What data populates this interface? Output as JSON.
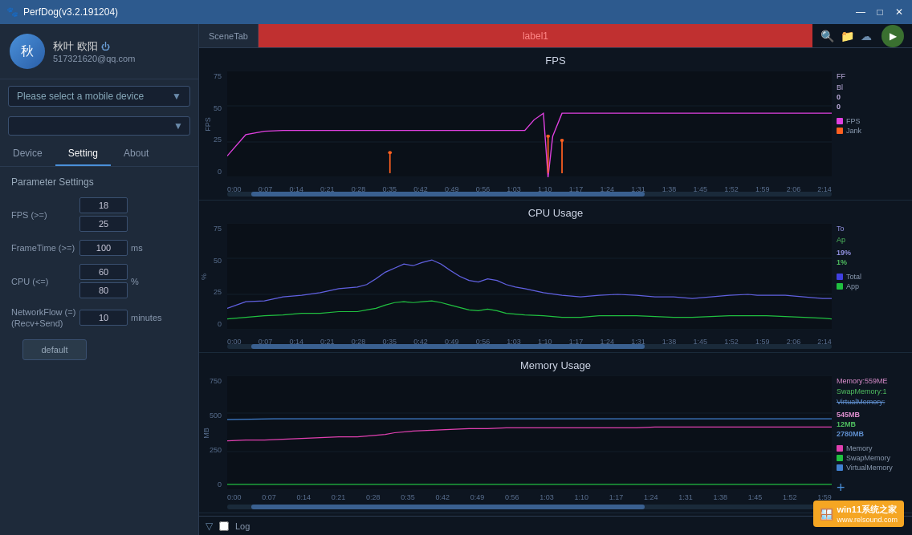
{
  "titlebar": {
    "title": "PerfDog(v3.2.191204)",
    "icon": "🐾",
    "min_btn": "—",
    "max_btn": "□",
    "close_btn": "✕"
  },
  "sidebar": {
    "user": {
      "name": "秋叶 欧阳",
      "email": "517321620@qq.com",
      "power_icon": "⏻"
    },
    "device_selector": {
      "placeholder": "Please select a mobile device",
      "arrow": "▼"
    },
    "search_arrow": "▼",
    "tabs": [
      {
        "id": "device",
        "label": "Device",
        "active": false
      },
      {
        "id": "setting",
        "label": "Setting",
        "active": true
      },
      {
        "id": "about",
        "label": "About",
        "active": false
      }
    ],
    "params": {
      "title": "Parameter Settings",
      "rows": [
        {
          "label": "FPS (>=)",
          "values": [
            "18",
            "25"
          ],
          "unit": ""
        },
        {
          "label": "FrameTime (>=)",
          "values": [
            "100"
          ],
          "unit": "ms"
        },
        {
          "label": "CPU (<=)",
          "values": [
            "60",
            "80"
          ],
          "unit": "%"
        },
        {
          "label": "NetworkFlow (=)\n(Recv+Send)",
          "values": [
            "10"
          ],
          "unit": "minutes"
        }
      ]
    },
    "default_btn": "default"
  },
  "main": {
    "scene_tab": {
      "tab_label": "SceneTab",
      "content_label": "label1",
      "icons": [
        "🔍",
        "📁",
        "☁"
      ],
      "play_btn": "▶"
    },
    "charts": [
      {
        "id": "fps",
        "title": "FPS",
        "y_label": "FPS",
        "y_ticks": [
          "75",
          "50",
          "25",
          "0"
        ],
        "x_ticks": [
          "0:00",
          "0:07",
          "0:14",
          "0:21",
          "0:28",
          "0:35",
          "0:42",
          "0:49",
          "0:56",
          "1:03",
          "1:10",
          "1:17",
          "1:24",
          "1:31",
          "1:38",
          "1:45",
          "1:52",
          "1:59",
          "2:06",
          "2:14"
        ],
        "legend": [
          {
            "label": "FPS",
            "color": "#e040e0",
            "current": "FF",
            "value": "0"
          },
          {
            "label": "Jank",
            "color": "#ff6020",
            "current": "Bl",
            "value": "0"
          }
        ],
        "scrollbar": {
          "left": "5%",
          "width": "70%"
        }
      },
      {
        "id": "cpu",
        "title": "CPU Usage",
        "y_label": "%",
        "y_ticks": [
          "75",
          "50",
          "25",
          "0"
        ],
        "x_ticks": [
          "0:00",
          "0:07",
          "0:14",
          "0:21",
          "0:28",
          "0:35",
          "0:42",
          "0:49",
          "0:56",
          "1:03",
          "1:10",
          "1:17",
          "1:24",
          "1:31",
          "1:38",
          "1:45",
          "1:52",
          "1:59",
          "2:06",
          "2:14"
        ],
        "legend": [
          {
            "label": "Total",
            "color": "#4040e0",
            "current": "To",
            "value": "19%"
          },
          {
            "label": "App",
            "color": "#20c040",
            "current": "Ap",
            "value": "1%"
          }
        ],
        "scrollbar": {
          "left": "5%",
          "width": "70%"
        }
      },
      {
        "id": "memory",
        "title": "Memory Usage",
        "y_label": "MB",
        "y_ticks": [
          "750",
          "500",
          "250",
          "0"
        ],
        "x_ticks": [
          "0:00",
          "0:07",
          "0:14",
          "0:21",
          "0:28",
          "0:35",
          "0:42",
          "0:49",
          "0:56",
          "1:03",
          "1:10",
          "1:17",
          "1:24",
          "1:31",
          "1:38",
          "1:45",
          "1:52",
          "1:59"
        ],
        "legend": [
          {
            "label": "Memory",
            "color": "#e040b0",
            "current": "Memory:559ME",
            "value": "545MB"
          },
          {
            "label": "SwapMemory",
            "color": "#20c040",
            "current": "SwapMemory:1",
            "value": "12MB"
          },
          {
            "label": "VirtualMemory",
            "color": "#4080d0",
            "current": "VirtualMemory:",
            "value": "2780MB"
          }
        ],
        "scrollbar": {
          "left": "5%",
          "width": "70%"
        }
      }
    ],
    "log_bar": {
      "arrow": "▽",
      "checkbox_label": "Log"
    }
  },
  "watermark": {
    "text": "win11系统之家",
    "url_text": "www.relsound.com"
  }
}
